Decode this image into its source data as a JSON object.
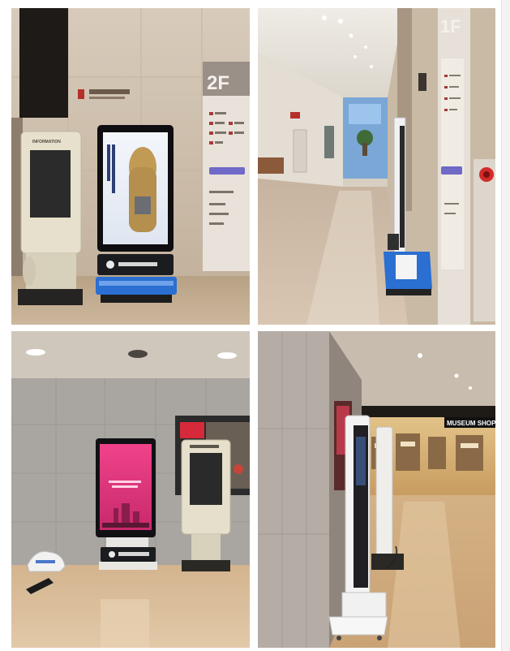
{
  "photos": {
    "top_left": {
      "floor_sign": "2F",
      "kiosk_label": "INFORMATION"
    },
    "top_right": {
      "floor_sign": "1F"
    },
    "bottom_right": {
      "shop_sign": "MUSEUM SHOP"
    }
  },
  "colors": {
    "background": "#ffffff",
    "kiosk_blue": "#2a6fd1",
    "screen_pink": "#e0357a",
    "marble_wall": "#d9cbb9",
    "floor": "#c9a887"
  }
}
